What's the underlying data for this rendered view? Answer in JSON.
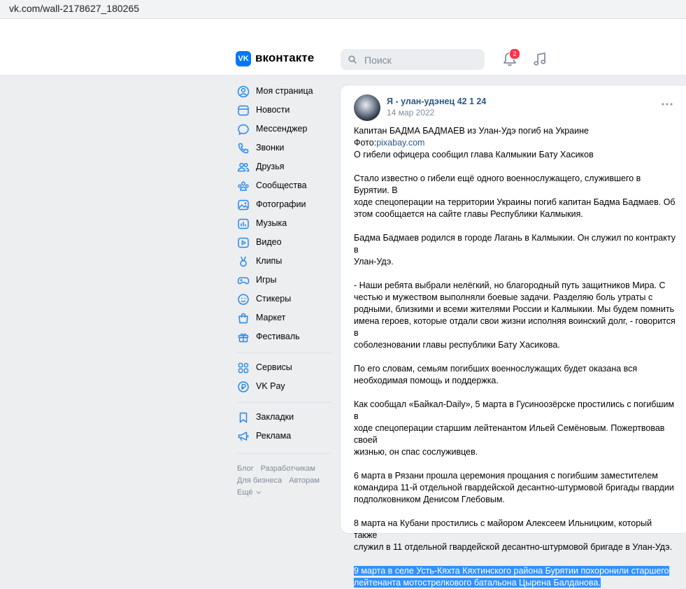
{
  "browser": {
    "url": "vk.com/wall-2178627_180265"
  },
  "header": {
    "logo_mark": "VK",
    "logo_text": "вконтакте",
    "search_placeholder": "Поиск",
    "notifications_count": "2"
  },
  "sidebar": {
    "items": [
      {
        "label": "Моя страница",
        "icon": "user-circle-icon"
      },
      {
        "label": "Новости",
        "icon": "news-icon"
      },
      {
        "label": "Мессенджер",
        "icon": "message-icon"
      },
      {
        "label": "Звонки",
        "icon": "phone-icon"
      },
      {
        "label": "Друзья",
        "icon": "friends-icon"
      },
      {
        "label": "Сообщества",
        "icon": "communities-icon"
      },
      {
        "label": "Фотографии",
        "icon": "photo-icon"
      },
      {
        "label": "Музыка",
        "icon": "music-icon"
      },
      {
        "label": "Видео",
        "icon": "video-icon"
      },
      {
        "label": "Клипы",
        "icon": "clips-icon"
      },
      {
        "label": "Игры",
        "icon": "gamepad-icon"
      },
      {
        "label": "Стикеры",
        "icon": "sticker-icon"
      },
      {
        "label": "Маркет",
        "icon": "market-icon"
      },
      {
        "label": "Фестиваль",
        "icon": "gift-icon"
      }
    ],
    "items2": [
      {
        "label": "Сервисы",
        "icon": "services-icon"
      },
      {
        "label": "VK Pay",
        "icon": "vkpay-icon"
      }
    ],
    "items3": [
      {
        "label": "Закладки",
        "icon": "bookmark-icon"
      },
      {
        "label": "Реклама",
        "icon": "megaphone-icon"
      }
    ],
    "footer": {
      "blog": "Блог",
      "developers": "Разработчикам",
      "business": "Для бизнеса",
      "authors": "Авторам",
      "more": "Ещё"
    }
  },
  "post": {
    "author": "Я - улан-удэнец 42 1 24",
    "date": "14 мар 2022",
    "title_line": "Капитан БАДМА БАДМАЕВ из Улан-Удэ погиб на Украине",
    "photo_prefix": "Фото:",
    "photo_link": "pixabay.com",
    "line3": "О гибели офицера сообщил глава Калмыкии Бату Хасиков",
    "p1_l1": "Стало известно о гибели ещё одного военнослужащего, служившего в Бурятии. В",
    "p1_l2": "ходе спецоперации на территории Украины погиб капитан Бадма Бадмаев. Об",
    "p1_l3": "этом сообщается на сайте главы Республики Калмыкия.",
    "p2_l1": "Бадма Бадмаев родился в городе Лагань в Калмыкии. Он служил по контракту в",
    "p2_l2": "Улан-Удэ.",
    "p3_l1": "- Наши ребята выбрали нелёгкий, но благородный путь защитников Мира. С",
    "p3_l2": "честью и мужеством выполняли боевые задачи. Разделяю боль утраты с",
    "p3_l3": "родными, близкими и всеми жителями России и Калмыкии. Мы будем помнить",
    "p3_l4": "имена героев, которые отдали свои жизни исполняя воинский долг, - говорится в",
    "p3_l5": "соболезновании главы республики Бату Хасикова.",
    "p4_l1": "По его словам, семьям погибших военнослужащих будет оказана вся",
    "p4_l2": "необходимая помощь и поддержка.",
    "p5_l1": "Как сообщал «Байкал-Daily», 5 марта в Гусиноозёрске простились с погибшим в",
    "p5_l2": "ходе спецоперации старшим лейтенантом Ильей Семёновым. Пожертвовав своей",
    "p5_l3": "жизнью, он спас сослуживцев.",
    "p6_l1": "6 марта в Рязани прошла церемония прощания с погибшим заместителем",
    "p6_l2": "командира 11-й отдельной гвардейской десантно-штурмовой бригады гвардии",
    "p6_l3": "подполковником Денисом Глебовым.",
    "p7_l1": "8 марта на Кубани простились с майором Алексеем Ильницким, который также",
    "p7_l2": "служил в 11 отдельной гвардейской десантно-штурмовой бригаде в Улан-Удэ.",
    "p8_l1": "9 марта в селе Усть-Кяхта Кяхтинского района Бурятии похоронили старшего",
    "p8_l2": "лейтенанта мотострелкового батальона Цырена Балданова."
  },
  "colors": {
    "accent": "#0077ff",
    "link": "#2a5885",
    "badge": "#ff3347",
    "selection": "#3390ff"
  }
}
